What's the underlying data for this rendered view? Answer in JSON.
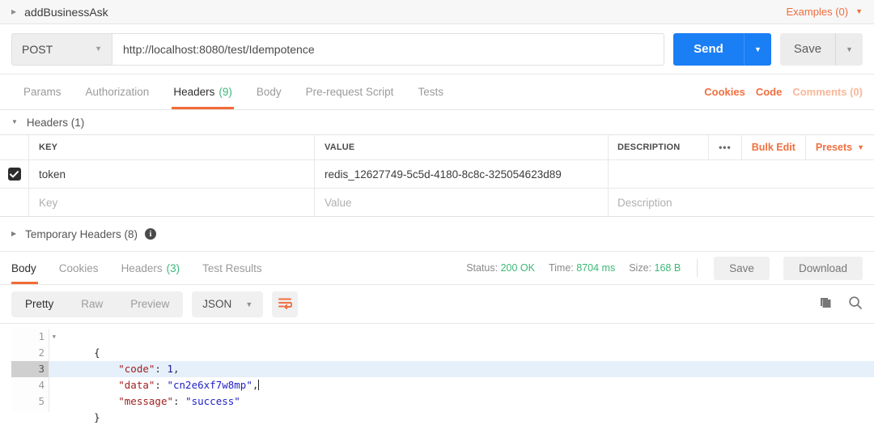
{
  "tab": {
    "title": "addBusinessAsk",
    "caret_icon": "caret-right-icon",
    "examples_label": "Examples (0)",
    "examples_caret_icon": "caret-down-icon"
  },
  "request": {
    "method": "POST",
    "method_caret_icon": "caret-down-icon",
    "url": "http://localhost:8080/test/Idempotence",
    "url_placeholder": "Enter request URL",
    "send_label": "Send",
    "send_caret_icon": "caret-down-icon",
    "save_label": "Save",
    "save_caret_icon": "caret-down-icon",
    "tabs": [
      {
        "label": "Params",
        "count": "",
        "active": false
      },
      {
        "label": "Authorization",
        "count": "",
        "active": false
      },
      {
        "label": "Headers",
        "count": "(9)",
        "active": true
      },
      {
        "label": "Body",
        "count": "",
        "active": false
      },
      {
        "label": "Pre-request Script",
        "count": "",
        "active": false
      },
      {
        "label": "Tests",
        "count": "",
        "active": false
      }
    ],
    "links": {
      "cookies": "Cookies",
      "code": "Code",
      "comments": "Comments (0)"
    }
  },
  "headers_section": {
    "title": "Headers (1)",
    "caret_icon": "caret-down-icon",
    "columns": {
      "key": "KEY",
      "value": "VALUE",
      "description": "DESCRIPTION"
    },
    "tools": {
      "more_icon": "ellipsis-icon",
      "more_label": "•••",
      "bulk_edit": "Bulk Edit",
      "presets": "Presets",
      "presets_caret_icon": "caret-down-icon"
    },
    "rows": [
      {
        "checked": true,
        "key": "token",
        "value": "redis_12627749-5c5d-4180-8c8c-325054623d89",
        "description": ""
      }
    ],
    "empty_row": {
      "key_placeholder": "Key",
      "value_placeholder": "Value",
      "description_placeholder": "Description"
    }
  },
  "temporary_headers": {
    "title": "Temporary Headers (8)",
    "caret_icon": "caret-right-icon",
    "info_icon": "info-icon",
    "info_glyph": "i"
  },
  "response": {
    "tabs": [
      {
        "label": "Body",
        "count": "",
        "active": true
      },
      {
        "label": "Cookies",
        "count": "",
        "active": false
      },
      {
        "label": "Headers",
        "count": "(3)",
        "active": false
      },
      {
        "label": "Test Results",
        "count": "",
        "active": false
      }
    ],
    "meta": {
      "status_label": "Status:",
      "status_value": "200 OK",
      "time_label": "Time:",
      "time_value": "8704 ms",
      "size_label": "Size:",
      "size_value": "168 B"
    },
    "save_label": "Save",
    "download_label": "Download",
    "format_tabs": [
      {
        "label": "Pretty",
        "active": true
      },
      {
        "label": "Raw",
        "active": false
      },
      {
        "label": "Preview",
        "active": false
      }
    ],
    "language": "JSON",
    "language_caret_icon": "caret-down-icon",
    "wrap_icon": "word-wrap-icon",
    "copy_icon": "copy-icon",
    "search_icon": "search-icon",
    "code_lines": [
      {
        "n": "1",
        "foldable": true,
        "highlighted": false,
        "tokens": [
          {
            "t": "punc",
            "v": "{"
          }
        ]
      },
      {
        "n": "2",
        "foldable": false,
        "highlighted": false,
        "tokens": [
          {
            "t": "key",
            "v": "    \"code\""
          },
          {
            "t": "punc",
            "v": ": "
          },
          {
            "t": "num",
            "v": "1"
          },
          {
            "t": "punc",
            "v": ","
          }
        ]
      },
      {
        "n": "3",
        "foldable": false,
        "highlighted": true,
        "cursor": true,
        "tokens": [
          {
            "t": "key",
            "v": "    \"data\""
          },
          {
            "t": "punc",
            "v": ": "
          },
          {
            "t": "str",
            "v": "\"cn2e6xf7w8mp\""
          },
          {
            "t": "punc",
            "v": ","
          }
        ]
      },
      {
        "n": "4",
        "foldable": false,
        "highlighted": false,
        "tokens": [
          {
            "t": "key",
            "v": "    \"message\""
          },
          {
            "t": "punc",
            "v": ": "
          },
          {
            "t": "str",
            "v": "\"success\""
          }
        ]
      },
      {
        "n": "5",
        "foldable": false,
        "highlighted": false,
        "tokens": [
          {
            "t": "punc",
            "v": "}"
          }
        ]
      }
    ]
  },
  "colors": {
    "accent_orange": "#f0703f",
    "send_blue": "#1a7ef4",
    "status_green": "#3cb878",
    "json_key": "#a02020",
    "json_string": "#1f1fc4"
  }
}
